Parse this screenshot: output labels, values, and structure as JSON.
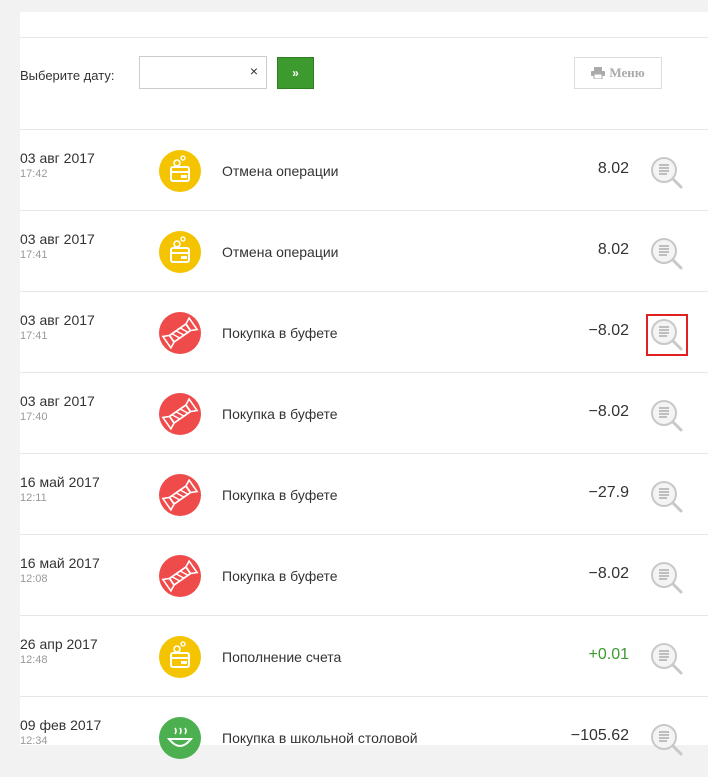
{
  "filter": {
    "label": "Выберите дату:",
    "date_value": "",
    "date_placeholder": "",
    "clear_symbol": "×",
    "go_symbol": "»",
    "menu_label": "Меню"
  },
  "transactions": [
    {
      "date": "03 авг 2017",
      "time": "17:42",
      "title": "Отмена операции",
      "amount": "8.02",
      "icon": "wallet-coin-icon",
      "highlighted": false
    },
    {
      "date": "03 авг 2017",
      "time": "17:41",
      "title": "Отмена операции",
      "amount": "8.02",
      "icon": "wallet-coin-icon",
      "highlighted": false
    },
    {
      "date": "03 авг 2017",
      "time": "17:41",
      "title": "Покупка в буфете",
      "amount": "−8.02",
      "icon": "candy-icon",
      "highlighted": true
    },
    {
      "date": "03 авг 2017",
      "time": "17:40",
      "title": "Покупка в буфете",
      "amount": "−8.02",
      "icon": "candy-icon",
      "highlighted": false
    },
    {
      "date": "16 май 2017",
      "time": "12:11",
      "title": "Покупка в буфете",
      "amount": "−27.9",
      "icon": "candy-icon",
      "highlighted": false
    },
    {
      "date": "16 май 2017",
      "time": "12:08",
      "title": "Покупка в буфете",
      "amount": "−8.02",
      "icon": "candy-icon",
      "highlighted": false
    },
    {
      "date": "26 апр 2017",
      "time": "12:48",
      "title": "Пополнение счета",
      "amount": "+0.01",
      "icon": "wallet-coin-icon",
      "highlighted": false
    },
    {
      "date": "09 фев 2017",
      "time": "12:34",
      "title": "Покупка в школьной столовой",
      "amount": "−105.62",
      "icon": "food-bowl-icon",
      "highlighted": false
    }
  ],
  "colors": {
    "yellow_icon": "#f5c400",
    "red_icon": "#f04b4b",
    "green_icon": "#4caf50",
    "go_button": "#3c9a2f",
    "positive_amount": "#3c9a2f",
    "highlight_border": "#e02020"
  }
}
